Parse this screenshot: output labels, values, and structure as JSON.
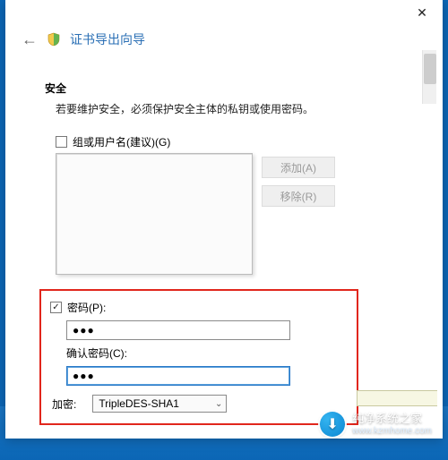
{
  "window": {
    "title": "证书导出向导",
    "close_glyph": "✕",
    "back_glyph": "←"
  },
  "security": {
    "heading": "安全",
    "description": "若要维护安全，必须保护安全主体的私钥或使用密码。"
  },
  "group": {
    "checkbox_label": "组或用户名(建议)(G)"
  },
  "buttons": {
    "add": "添加(A)",
    "remove": "移除(R)"
  },
  "password": {
    "checkbox_label": "密码(P):",
    "value": "●●●",
    "confirm_label": "确认密码(C):",
    "confirm_value": "●●●"
  },
  "encryption": {
    "label": "加密:",
    "selected": "TripleDES-SHA1",
    "caret": "⌄"
  },
  "watermark": {
    "name": "纯净系统之家",
    "url": "www.kzmhome.com",
    "badge_glyph": "⬇"
  }
}
